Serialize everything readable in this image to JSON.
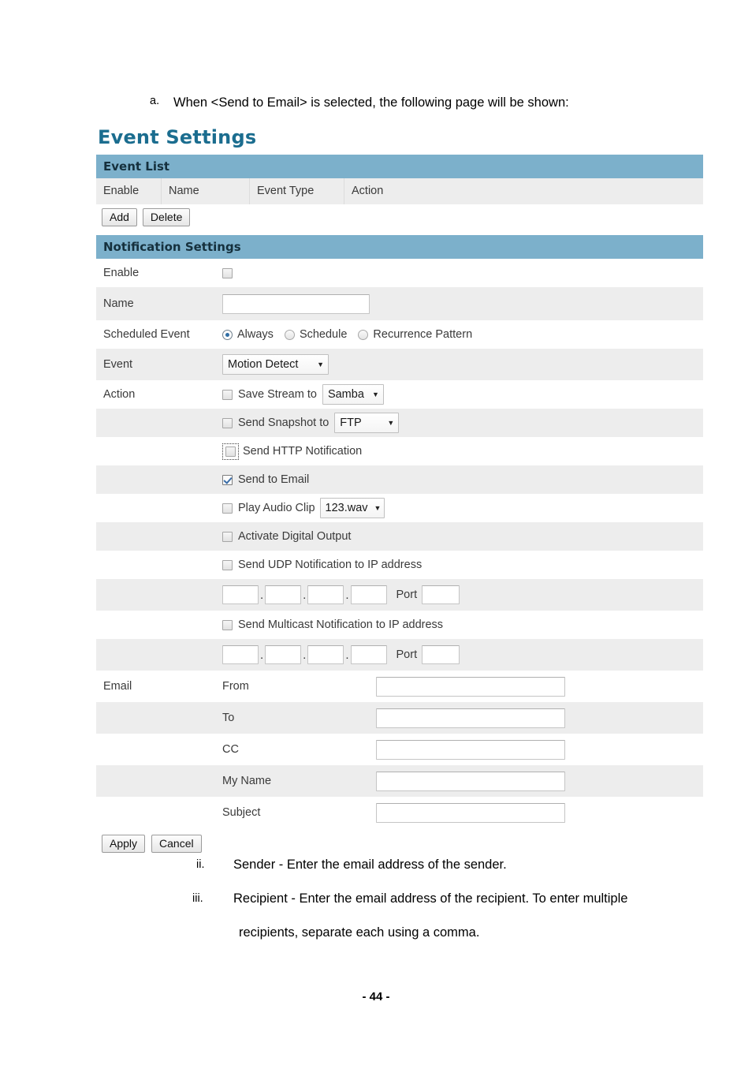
{
  "document": {
    "intro_marker": "a.",
    "intro_text": "When <Send to Email> is selected, the following page will be shown:",
    "notes": [
      {
        "marker": "ii.",
        "lines": [
          "Sender - Enter the email address of the sender."
        ]
      },
      {
        "marker": "iii.",
        "lines": [
          "Recipient - Enter the email address of the recipient. To enter multiple",
          "recipients, separate each using a comma."
        ]
      }
    ],
    "page_number": "- 44 -"
  },
  "panel": {
    "title": "Event Settings",
    "event_list": {
      "bar_label": "Event List",
      "columns": [
        "Enable",
        "Name",
        "Event Type",
        "Action"
      ],
      "buttons": {
        "add": "Add",
        "delete": "Delete"
      }
    },
    "notification": {
      "bar_label": "Notification Settings",
      "enable": {
        "label": "Enable",
        "checked": false
      },
      "name": {
        "label": "Name",
        "value": "",
        "placeholder": ""
      },
      "scheduled_event": {
        "label": "Scheduled Event",
        "options": [
          "Always",
          "Schedule",
          "Recurrence Pattern"
        ],
        "selected": "Always"
      },
      "event": {
        "label": "Event",
        "selected": "Motion Detect"
      },
      "action": {
        "label": "Action",
        "items": [
          {
            "label": "Save Stream to",
            "checked": false,
            "dropdown": "Samba",
            "dropdown_class": "sel-samba"
          },
          {
            "label": "Send Snapshot to",
            "checked": false,
            "dropdown": "FTP",
            "dropdown_class": "sel-ftp"
          },
          {
            "label": "Send HTTP Notification",
            "checked": false,
            "focused": true
          },
          {
            "label": "Send to Email",
            "checked": true
          },
          {
            "label": "Play Audio Clip",
            "checked": false,
            "dropdown": "123.wav",
            "dropdown_class": "sel-audio"
          },
          {
            "label": "Activate Digital Output",
            "checked": false
          },
          {
            "label": "Send UDP Notification to IP address",
            "checked": false
          },
          {
            "label": "Send Multicast Notification to IP address",
            "checked": false
          }
        ],
        "udp_ip": {
          "octets": [
            "",
            "",
            "",
            ""
          ],
          "port_label": "Port",
          "port": ""
        },
        "multicast_ip": {
          "octets": [
            "",
            "",
            "",
            ""
          ],
          "port_label": "Port",
          "port": ""
        }
      },
      "email": {
        "label": "Email",
        "fields": [
          {
            "label": "From",
            "value": ""
          },
          {
            "label": "To",
            "value": ""
          },
          {
            "label": "CC",
            "value": ""
          },
          {
            "label": "My Name",
            "value": ""
          },
          {
            "label": "Subject",
            "value": ""
          }
        ]
      },
      "footer_buttons": {
        "apply": "Apply",
        "cancel": "Cancel"
      }
    }
  },
  "colors": {
    "bar_blue": "#7cb0cb",
    "title_blue": "#1b6d8f",
    "row_alt": "#ededed",
    "check_blue": "#3b6ea8"
  }
}
